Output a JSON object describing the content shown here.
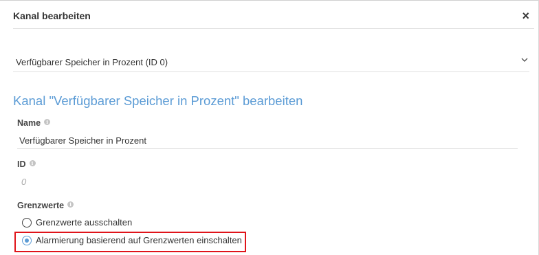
{
  "dialog": {
    "title": "Kanal bearbeiten",
    "close_label": "×"
  },
  "channel_select": {
    "value": "Verfügbarer Speicher in Prozent (ID 0)"
  },
  "section_title": "Kanal \"Verfügbarer Speicher in Prozent\" bearbeiten",
  "fields": {
    "name": {
      "label": "Name",
      "value": "Verfügbarer Speicher in Prozent"
    },
    "id": {
      "label": "ID",
      "value": "0"
    },
    "limits": {
      "label": "Grenzwerte",
      "options": [
        {
          "label": "Grenzwerte ausschalten",
          "checked": false
        },
        {
          "label": "Alarmierung basierend auf Grenzwerten einschalten",
          "checked": true
        }
      ]
    }
  },
  "icons": {
    "info": "info-icon",
    "close": "close-icon",
    "chevron": "chevron-down-icon"
  },
  "colors": {
    "accent": "#5b9bd5",
    "highlight": "#e0141a"
  }
}
